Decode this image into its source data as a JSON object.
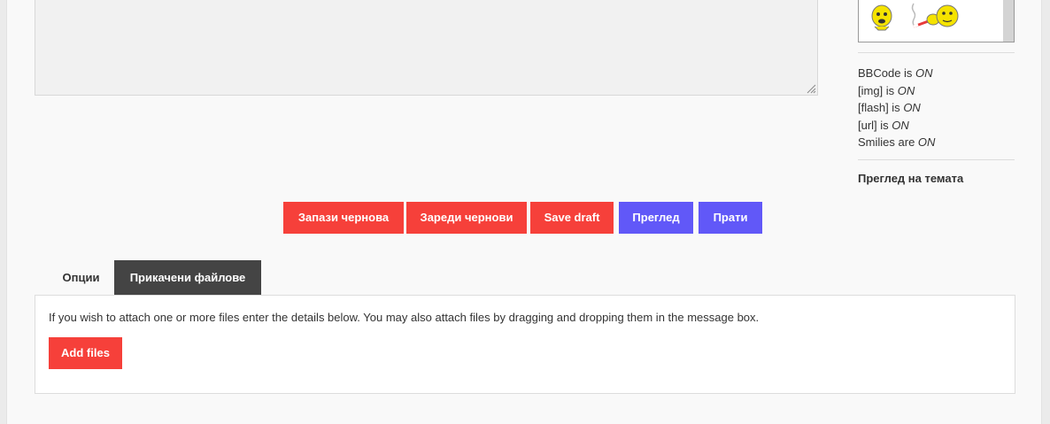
{
  "sidebar": {
    "bbcode_label": "BBCode is",
    "bbcode_status": "ON",
    "img_label": "[img] is",
    "img_status": "ON",
    "flash_label": "[flash] is",
    "flash_status": "ON",
    "url_label": "[url] is",
    "url_status": "ON",
    "smilies_label": "Smilies are",
    "smilies_status": "ON",
    "topic_review": "Преглед на темата"
  },
  "buttons": {
    "save_draft_bg": "Запази чернова",
    "load_drafts": "Зареди чернови",
    "save_draft_en": "Save draft",
    "preview": "Преглед",
    "submit": "Прати"
  },
  "tabs": {
    "options": "Опции",
    "attachments": "Прикачени файлове"
  },
  "attachments": {
    "info": "If you wish to attach one or more files enter the details below. You may also attach files by dragging and dropping them in the message box.",
    "add_files": "Add files"
  },
  "colors": {
    "red": "#f6403a",
    "blue": "#6158f8",
    "tab_active": "#444444"
  },
  "icons": [
    "smiley-icon",
    "smoking-smiley-icon",
    "resize-handle-icon"
  ]
}
